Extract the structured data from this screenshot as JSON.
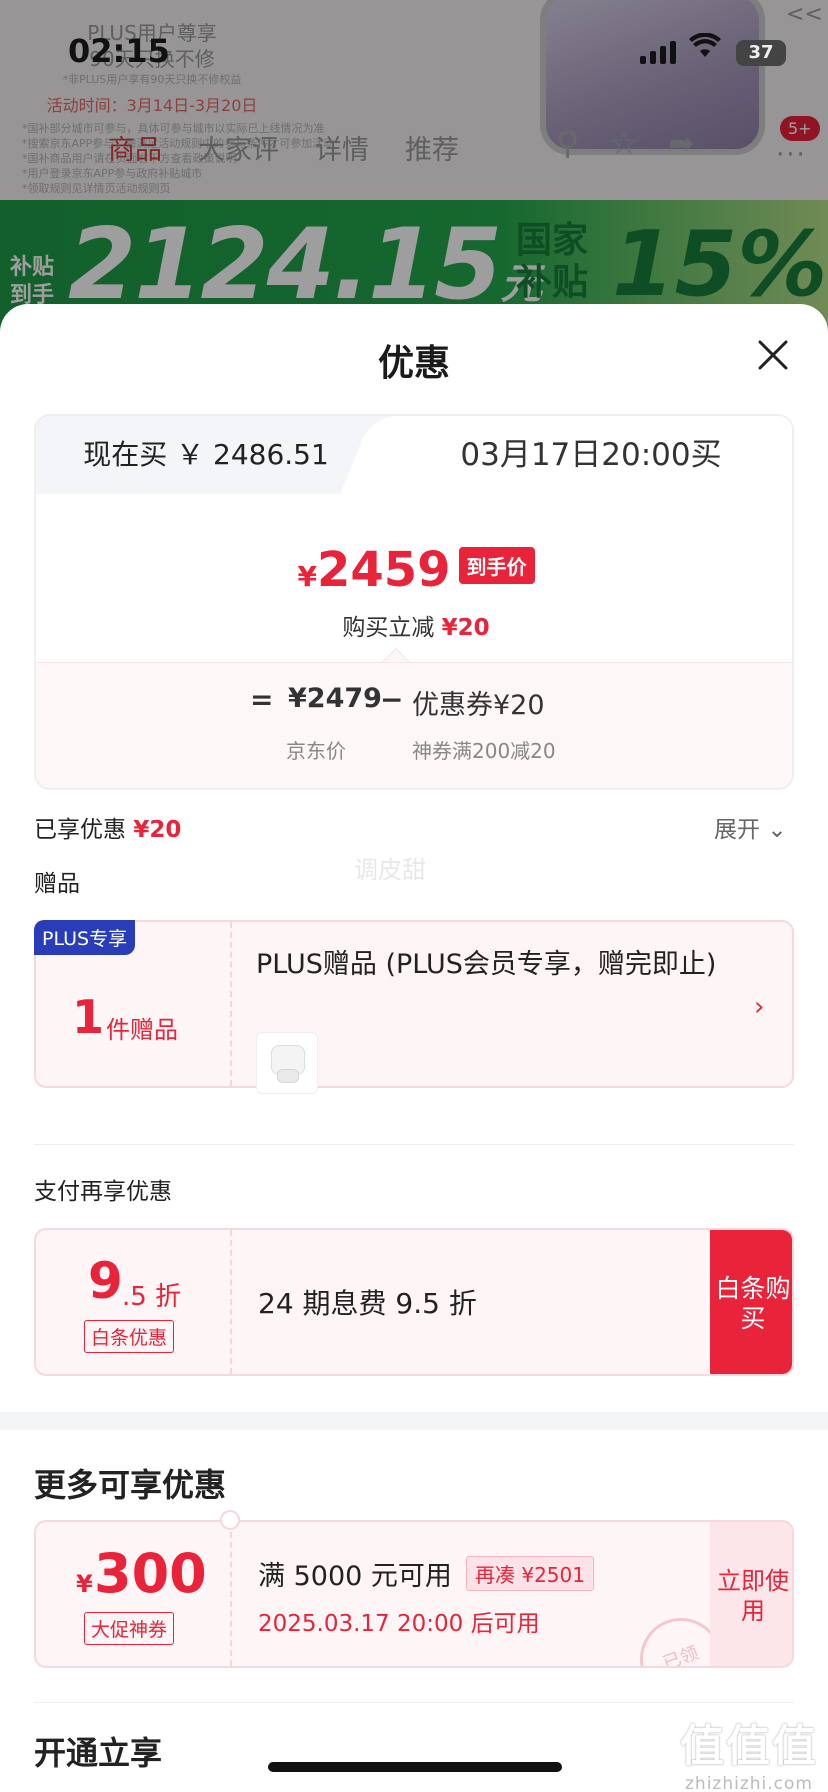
{
  "status_bar": {
    "time": "02:15",
    "battery": "37"
  },
  "background": {
    "promo_title": "PLUS用户尊享",
    "promo_subtitle": "90天只换不修",
    "promo_note": "*非PLUS用户享有90天只换不修权益",
    "promo_dates": "活动时间：3月14日-3月20日",
    "promo_fineprint": [
      "*国补部分城市可参与，具体可参与城市以实际已上线情况为准",
      "*搜索京东APP参与，需满足活动规则中的参与条件才可参加活动",
      "*国补商品用户请在页面右下方查看政策说明",
      "*用户登录京东APP参与政府补贴城市",
      "*领取规则见详情页活动规则页"
    ],
    "tabs": [
      "商品",
      "大家评",
      "详情",
      "推荐"
    ],
    "cart_badge": "5+",
    "collapse_icon": "<<",
    "banner_left": "补贴到手",
    "banner_amount": "2124.15",
    "banner_unit": "元",
    "banner_gov": "国家补贴",
    "banner_pct": "15%"
  },
  "sheet": {
    "title": "优惠",
    "tabs": {
      "now": "现在买 ￥ 2486.51",
      "later": "03月17日20:00买"
    },
    "price": {
      "currency": "¥",
      "amount": "2459",
      "tag": "到手价"
    },
    "reduce": {
      "label": "购买立减",
      "value": "¥20"
    },
    "formula": {
      "equals": "=",
      "jd_price": "¥2479",
      "minus": "−",
      "coupon": "优惠券¥20",
      "jd_label": "京东价",
      "coupon_label": "神券满200减20"
    },
    "enjoyed": {
      "label": "已享优惠",
      "value": "¥20"
    },
    "expand_label": "展开",
    "watermark": "调皮甜",
    "gift_section": {
      "label": "赠品",
      "badge": "PLUS专享",
      "count": "1",
      "unit": "件赠品",
      "title": "PLUS赠品 (PLUS会员专享，赠完即止)"
    },
    "pay_section": {
      "label": "支付再享优惠",
      "discount_big": "9",
      "discount_small": ".5 折",
      "badge": "白条优惠",
      "text": "24 期息费 9.5 折",
      "button": "白条购买"
    },
    "more_section": {
      "title": "更多可享优惠",
      "coupon_currency": "¥",
      "coupon_amount": "300",
      "coupon_badge": "大促神券",
      "condition": "满 5000 元可用",
      "add_tag": "再凑 ¥2501",
      "time": "2025.03.17 20:00 后可用",
      "button": "立即使用",
      "stamp": "已领"
    },
    "open_title": "开通立享",
    "site_mark": {
      "glyphs": "值值值",
      "url": "zhizhizhi.com"
    }
  },
  "colors": {
    "accent_red": "#e8233a",
    "plus_blue": "#2a3db8",
    "banner_green": "#22a84c"
  }
}
